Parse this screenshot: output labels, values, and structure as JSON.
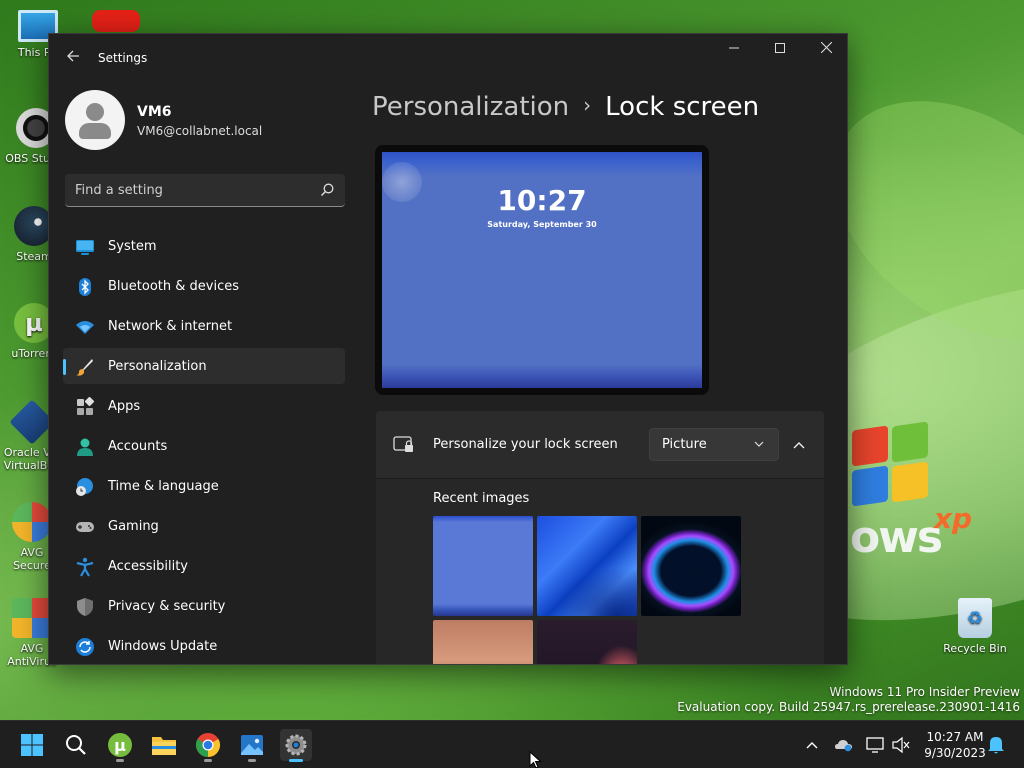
{
  "desktop": {
    "icons": [
      {
        "label": "This PC"
      },
      {
        "label": "OBS Studio"
      },
      {
        "label": "Steam"
      },
      {
        "label": "uTorrent"
      },
      {
        "label": "Oracle VM VirtualBox"
      },
      {
        "label": "AVG Secure Browser"
      },
      {
        "label": "AVG AntiVirus Free"
      },
      {
        "label": "Recycle Bin"
      }
    ],
    "wallpaper_brand": "ows",
    "wallpaper_brand_suffix": "xp",
    "watermark_line1": "Windows 11 Pro Insider Preview",
    "watermark_line2": "Evaluation copy. Build 25947.rs_prerelease.230901-1416"
  },
  "window": {
    "title": "Settings",
    "back_icon": "back-arrow-icon",
    "minimize": "—",
    "maximize": "☐",
    "close": "✕"
  },
  "profile": {
    "name": "VM6",
    "email": "VM6@collabnet.local"
  },
  "search": {
    "placeholder": "Find a setting",
    "icon": "search-icon"
  },
  "nav": {
    "items": [
      {
        "label": "System",
        "icon": "system-icon"
      },
      {
        "label": "Bluetooth & devices",
        "icon": "bluetooth-icon"
      },
      {
        "label": "Network & internet",
        "icon": "wifi-icon"
      },
      {
        "label": "Personalization",
        "icon": "brush-icon",
        "active": true
      },
      {
        "label": "Apps",
        "icon": "apps-icon"
      },
      {
        "label": "Accounts",
        "icon": "accounts-icon"
      },
      {
        "label": "Time & language",
        "icon": "globe-clock-icon"
      },
      {
        "label": "Gaming",
        "icon": "gamepad-icon"
      },
      {
        "label": "Accessibility",
        "icon": "accessibility-icon"
      },
      {
        "label": "Privacy & security",
        "icon": "shield-icon"
      },
      {
        "label": "Windows Update",
        "icon": "update-icon"
      }
    ]
  },
  "content": {
    "breadcrumb_parent": "Personalization",
    "breadcrumb_sep": "›",
    "breadcrumb_current": "Lock screen",
    "preview_time": "10:27",
    "preview_date": "Saturday, September 30",
    "personalize_label": "Personalize your lock screen",
    "personalize_value": "Picture",
    "recent_images_title": "Recent images"
  },
  "taskbar": {
    "apps": [
      "start-icon",
      "search-icon",
      "utorrent-icon",
      "file-explorer-icon",
      "chrome-icon",
      "photos-icon",
      "settings-icon"
    ],
    "clock_time": "10:27 AM",
    "clock_date": "9/30/2023"
  },
  "colors": {
    "accent": "#4cc2ff",
    "window_bg": "#202020",
    "card_bg": "#2b2b2b"
  }
}
